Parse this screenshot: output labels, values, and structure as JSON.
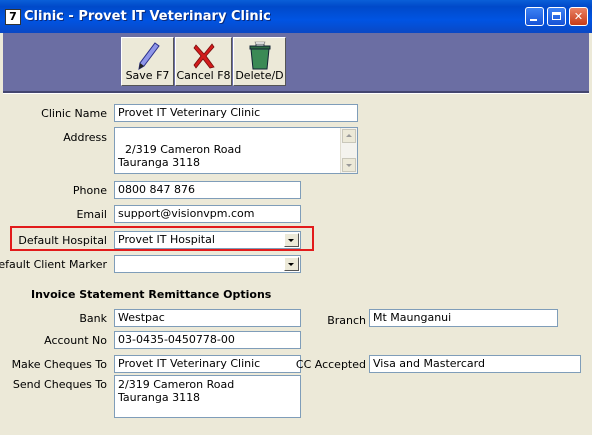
{
  "window": {
    "title": "Clinic - Provet IT Veterinary Clinic",
    "icon_glyph": "7"
  },
  "toolbar": {
    "save_label": "Save F7",
    "cancel_label": "Cancel F8",
    "delete_label": "Delete/D"
  },
  "fields": {
    "clinic_name": {
      "label": "Clinic Name",
      "value": "Provet IT Veterinary Clinic"
    },
    "address": {
      "label": "Address",
      "value": "2/319 Cameron Road\nTauranga 3118"
    },
    "phone": {
      "label": "Phone",
      "value": "0800 847 876"
    },
    "email": {
      "label": "Email",
      "value": "support@visionvpm.com"
    },
    "default_hospital": {
      "label": "Default Hospital",
      "value": "Provet IT Hospital"
    },
    "default_client_marker": {
      "label": "Default Client Marker",
      "value": ""
    }
  },
  "remittance": {
    "section_title": "Invoice Statement Remittance Options",
    "bank": {
      "label": "Bank",
      "value": "Westpac"
    },
    "branch": {
      "label": "Branch",
      "value": "Mt Maunganui"
    },
    "account_no": {
      "label": "Account No",
      "value": "03-0435-0450778-00"
    },
    "make_cheques_to": {
      "label": "Make Cheques To",
      "value": "Provet IT Veterinary Clinic"
    },
    "cc_accepted": {
      "label": "CC Accepted",
      "value": "Visa and Mastercard"
    },
    "send_cheques_to": {
      "label": "Send Cheques To",
      "value": "2/319 Cameron Road\nTauranga 3118"
    }
  },
  "colors": {
    "titlebar": "#0054e3",
    "toolbar": "#6b6ea3",
    "highlight": "#e21b1b",
    "form_bg": "#ece9d8"
  }
}
